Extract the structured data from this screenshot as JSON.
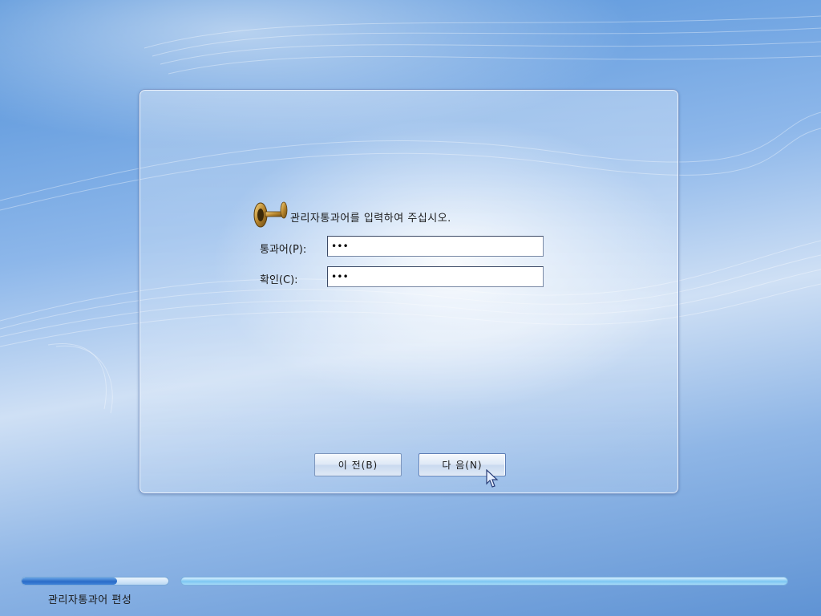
{
  "dialog": {
    "prompt": "관리자통과어를 입력하여 주십시오.",
    "password_label": "통과어(P):",
    "password_value": "•••",
    "confirm_label": "확인(C):",
    "confirm_value": "•••",
    "back_button": "이 전(B)",
    "next_button": "다 음(N)",
    "icon": "key-icon"
  },
  "footer": {
    "status_text": "관리자통과어 편성",
    "step_progress_fraction": 0.65,
    "overall_progress_fraction": 1.0
  },
  "colors": {
    "accent": "#2a6cc8",
    "progress_right": "#7cc6f2"
  }
}
